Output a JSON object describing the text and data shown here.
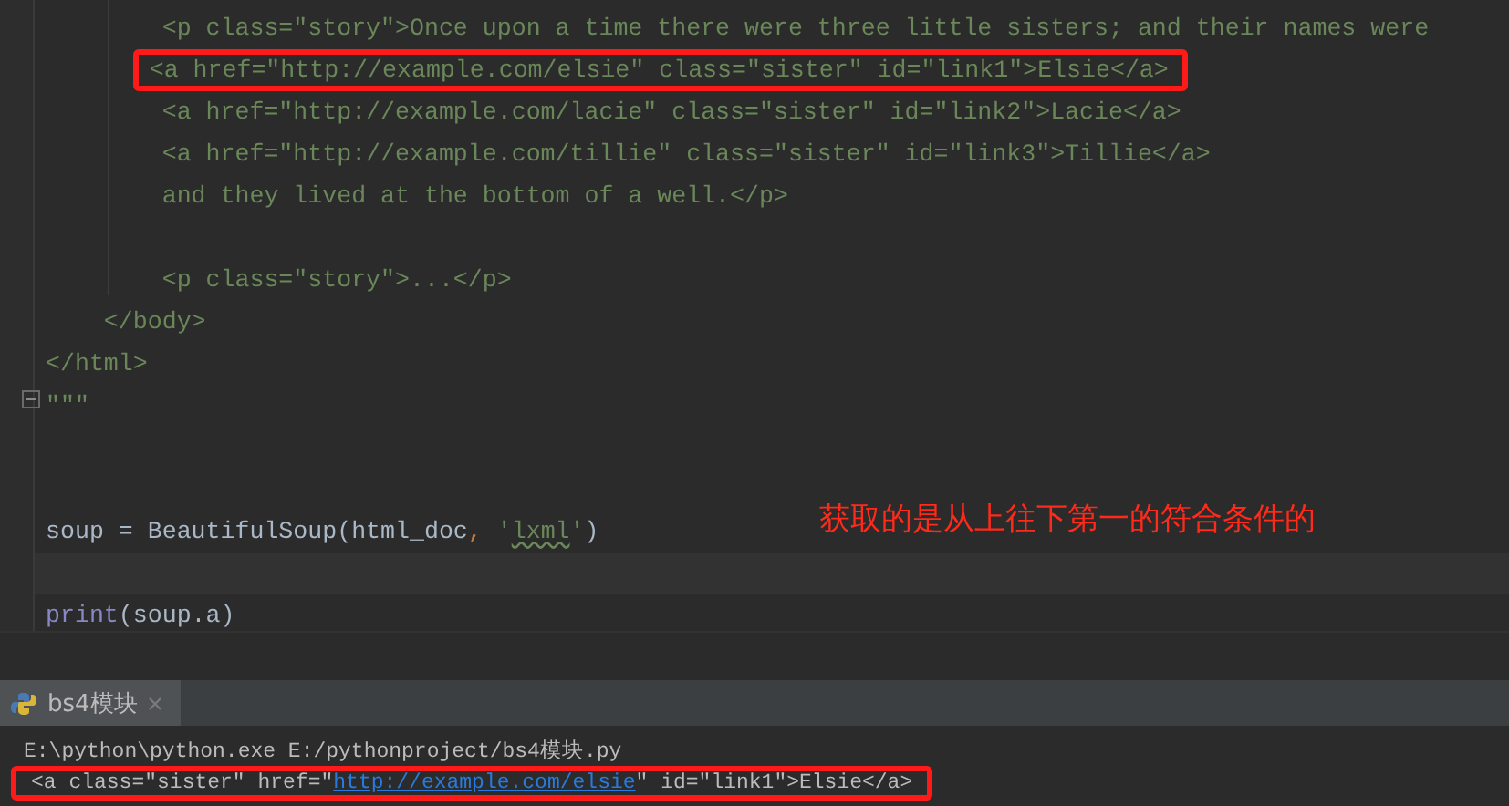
{
  "editor": {
    "lines": [
      {
        "current": false,
        "annotated": false,
        "segments": [
          {
            "kind": "string",
            "text": "        <p class=\"story\">Once upon a time there were three little sisters; and their names were"
          }
        ]
      },
      {
        "current": false,
        "annotated": true,
        "segments": [
          {
            "kind": "string",
            "text": "        <a href=\"http://example.com/elsie\" class=\"sister\" id=\"link1\">Elsie</a>"
          }
        ]
      },
      {
        "current": false,
        "annotated": false,
        "segments": [
          {
            "kind": "string",
            "text": "        <a href=\"http://example.com/lacie\" class=\"sister\" id=\"link2\">Lacie</a>"
          }
        ]
      },
      {
        "current": false,
        "annotated": false,
        "segments": [
          {
            "kind": "string",
            "text": "        <a href=\"http://example.com/tillie\" class=\"sister\" id=\"link3\">Tillie</a>"
          }
        ]
      },
      {
        "current": false,
        "annotated": false,
        "segments": [
          {
            "kind": "string",
            "text": "        and they lived at the bottom of a well.</p>"
          }
        ]
      },
      {
        "current": false
      },
      {
        "current": false,
        "annotated": false,
        "segments": [
          {
            "kind": "string",
            "text": "        <p class=\"story\">...</p>"
          }
        ]
      },
      {
        "current": false,
        "annotated": false,
        "segments": [
          {
            "kind": "string",
            "text": "    </body>"
          }
        ]
      },
      {
        "current": false,
        "annotated": false,
        "segments": [
          {
            "kind": "string",
            "text": "</html>"
          }
        ]
      },
      {
        "current": false,
        "annotated": false,
        "segments": [
          {
            "kind": "string",
            "text": "\"\"\""
          }
        ]
      },
      {
        "current": false
      },
      {
        "current": false
      },
      {
        "current": false,
        "annotated": false,
        "segments": [
          {
            "kind": "plain",
            "text": "soup = BeautifulSoup(html_doc"
          },
          {
            "kind": "comma",
            "text": ", "
          },
          {
            "kind": "string",
            "text": "'"
          },
          {
            "kind": "typo",
            "text": "lxml"
          },
          {
            "kind": "string",
            "text": "'"
          },
          {
            "kind": "plain",
            "text": ")"
          }
        ]
      },
      {
        "current": true
      },
      {
        "current": false,
        "annotated": false,
        "segments": [
          {
            "kind": "builtin",
            "text": "print"
          },
          {
            "kind": "plain",
            "text": "(soup.a)"
          }
        ]
      }
    ]
  },
  "annotation": {
    "text": "获取的是从上往下第一的符合条件的"
  },
  "run_panel": {
    "tab": {
      "label": "bs4模块",
      "selected": true
    },
    "lines": [
      {
        "annotated": false,
        "segments": [
          {
            "kind": "plain",
            "text": "E:\\python\\python.exe E:/pythonproject/bs4模块.py"
          }
        ]
      },
      {
        "annotated": true,
        "segments": [
          {
            "kind": "plain",
            "text": "<a class=\"sister\" href=\""
          },
          {
            "kind": "link",
            "text": "http://example.com/elsie"
          },
          {
            "kind": "plain",
            "text": "\" id=\"link1\">Elsie</a>"
          }
        ]
      }
    ]
  }
}
